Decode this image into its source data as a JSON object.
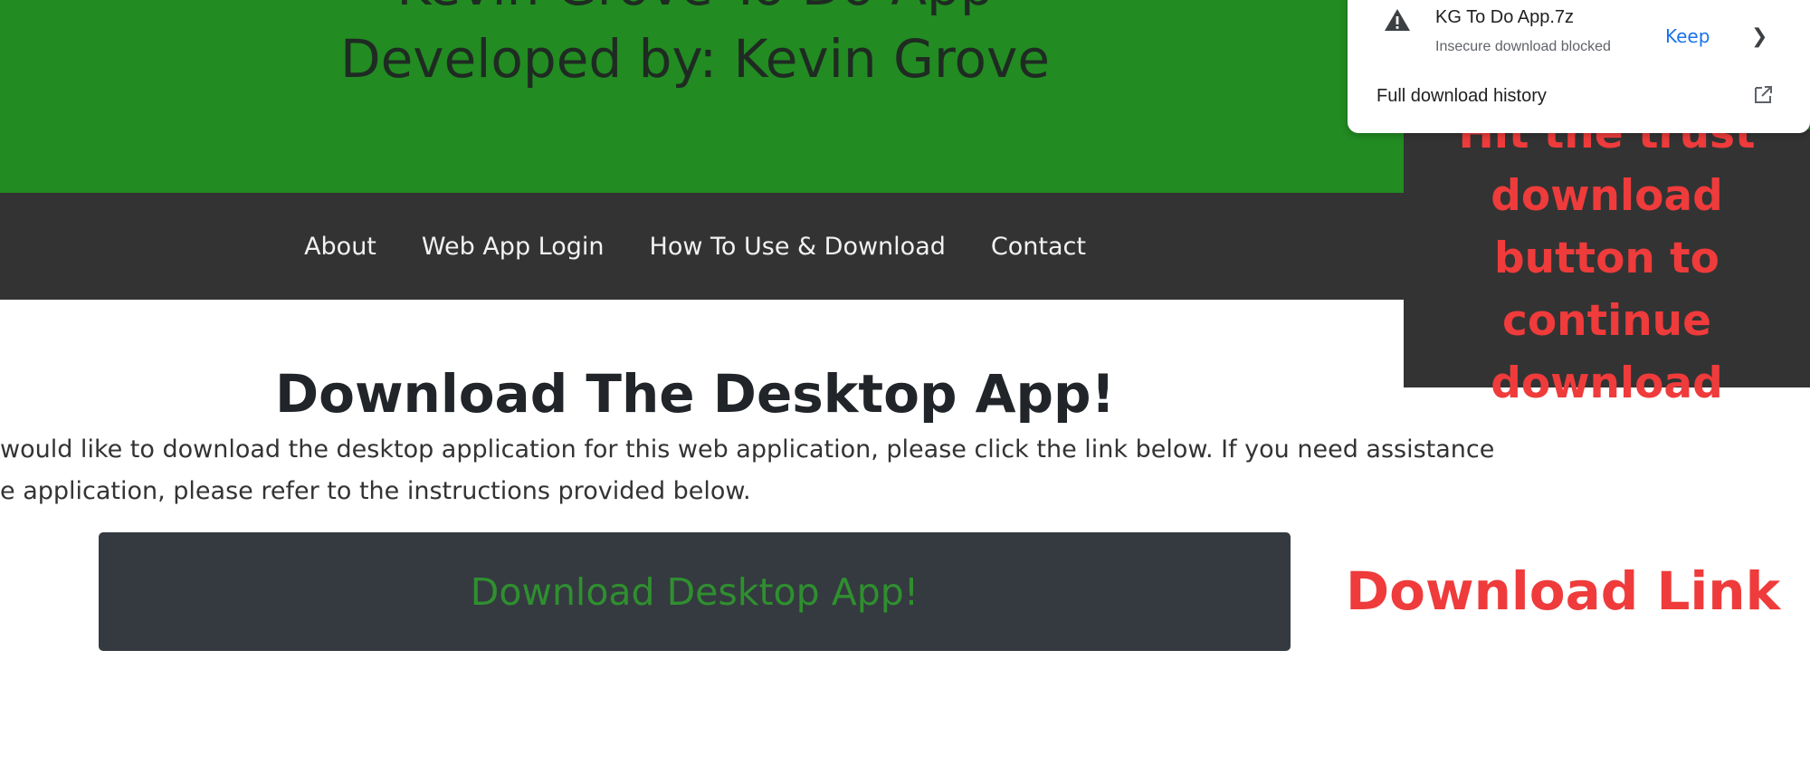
{
  "header": {
    "partial_text": "Kevin Grove To Do App",
    "developer_line": "Developed by: Kevin Grove",
    "background": "#228b22"
  },
  "nav": {
    "items": [
      {
        "label": "About"
      },
      {
        "label": "Web App Login"
      },
      {
        "label": "How To Use & Download"
      },
      {
        "label": "Contact"
      }
    ],
    "background": "#333333"
  },
  "main": {
    "title": "Download The Desktop App!",
    "intro_line_1": "would like to download the desktop application for this web application, please click the link below. If you need assistance",
    "intro_line_2": "e application, please refer to the instructions provided below.",
    "download_button_label": "Download Desktop App!",
    "download_button_color": "#343a40"
  },
  "annotations": {
    "download_link_label": "Download Link",
    "trust_message": "Hit the trust download button to continue download",
    "annotation_color": "#ef3b3b",
    "box_color": "#333333"
  },
  "download_panel": {
    "filename": "KG To Do App.7z",
    "status": "Insecure download blocked",
    "keep_label": "Keep",
    "chevron_icon": "chevron-right-icon",
    "warning_icon": "warning-icon",
    "history_label": "Full download history",
    "open_icon": "open-in-new-icon",
    "keep_color": "#1a73e8"
  }
}
